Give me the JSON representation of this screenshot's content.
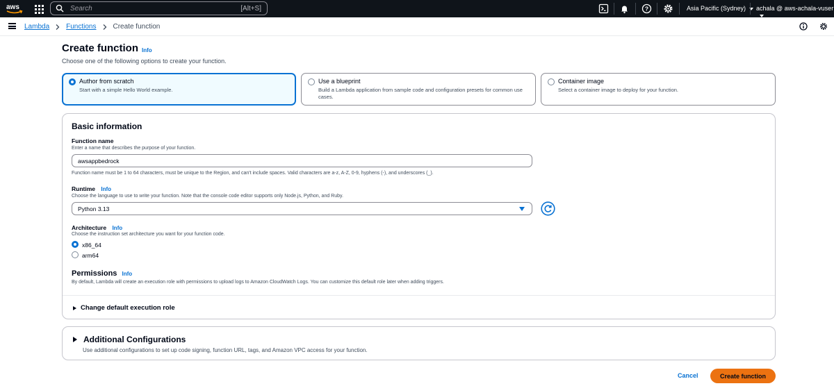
{
  "topnav": {
    "search_placeholder": "Search",
    "search_shortcut": "[Alt+S]",
    "region": "Asia Pacific (Sydney)",
    "account": "achala @ aws-achala-vuser"
  },
  "breadcrumb": {
    "items": [
      "Lambda",
      "Functions",
      "Create function"
    ]
  },
  "page": {
    "title": "Create function",
    "info": "Info",
    "subtitle": "Choose one of the following options to create your function."
  },
  "options": [
    {
      "title": "Author from scratch",
      "desc": "Start with a simple Hello World example.",
      "selected": true
    },
    {
      "title": "Use a blueprint",
      "desc": "Build a Lambda application from sample code and configuration presets for common use cases.",
      "selected": false
    },
    {
      "title": "Container image",
      "desc": "Select a container image to deploy for your function.",
      "selected": false
    }
  ],
  "basic": {
    "heading": "Basic information",
    "function_name": {
      "label": "Function name",
      "desc": "Enter a name that describes the purpose of your function.",
      "value": "awsappbedrock",
      "hint": "Function name must be 1 to 64 characters, must be unique to the Region, and can't include spaces. Valid characters are a-z, A-Z, 0-9, hyphens (-), and underscores (_)."
    },
    "runtime": {
      "label": "Runtime",
      "info": "Info",
      "desc": "Choose the language to use to write your function. Note that the console code editor supports only Node.js, Python, and Ruby.",
      "value": "Python 3.13"
    },
    "architecture": {
      "label": "Architecture",
      "info": "Info",
      "desc": "Choose the instruction set architecture you want for your function code.",
      "options": [
        "x86_64",
        "arm64"
      ],
      "selected": "x86_64"
    },
    "permissions": {
      "label": "Permissions",
      "info": "Info",
      "desc": "By default, Lambda will create an execution role with permissions to upload logs to Amazon CloudWatch Logs. You can customize this default role later when adding triggers."
    },
    "expander": "Change default execution role"
  },
  "additional": {
    "heading": "Additional Configurations",
    "desc": "Use additional configurations to set up code signing, function URL, tags, and Amazon VPC access for your function."
  },
  "footer": {
    "cancel": "Cancel",
    "create": "Create function"
  },
  "colors": {
    "accent": "#0972d3",
    "primary_button": "#ec7211",
    "topnav_bg": "#0f141a"
  }
}
